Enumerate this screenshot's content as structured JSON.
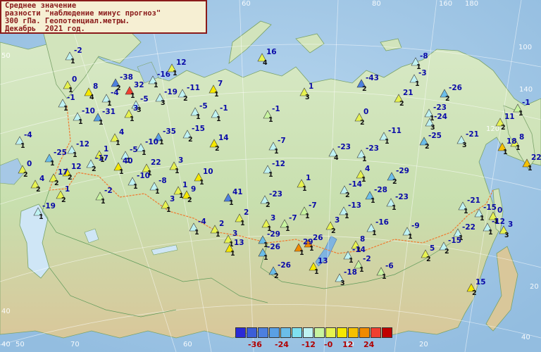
{
  "title": {
    "line1": "Среднее значение",
    "line2": "разности \"наблюдение минус прогноз\"",
    "line3": "300 гПа. Геопотенциал.метры.",
    "line4": "Декабрь  2021 год."
  },
  "scale": {
    "colors": [
      "#2b2bd6",
      "#3b5ed8",
      "#4c7fde",
      "#5aa0e4",
      "#6bbde8",
      "#7fe0f0",
      "#bff2f2",
      "#c8f4a0",
      "#e6f250",
      "#f5e800",
      "#f5c000",
      "#f08a00",
      "#f04030",
      "#c00000"
    ],
    "labels": [
      "-36",
      "-24",
      "-12",
      "-0",
      "12",
      "24"
    ]
  },
  "grid_labels": [
    "60",
    "80",
    "100",
    "120",
    "140",
    "160",
    "180",
    "40",
    "40",
    "50",
    "50",
    "60",
    "70",
    "60",
    "40",
    "40",
    "20",
    "20"
  ],
  "stations": [
    {
      "v": "-2",
      "n": "1",
      "c": "#bff2f2"
    },
    {
      "v": "0",
      "n": "1",
      "c": "#e6f250"
    },
    {
      "v": "8",
      "n": "4",
      "c": "#f5e800"
    },
    {
      "v": "-1",
      "n": "1",
      "c": "#bff2f2"
    },
    {
      "v": "-4",
      "n": "1",
      "c": "#bff2f2"
    },
    {
      "v": "-38",
      "n": "2",
      "c": "#4c7fde"
    },
    {
      "v": "32",
      "n": "1",
      "c": "#f04030"
    },
    {
      "v": "-16",
      "n": "1",
      "c": "#bff2f2"
    },
    {
      "v": "12",
      "n": "1",
      "c": "#e6f250"
    },
    {
      "v": "-5",
      "n": "3",
      "c": "#bff2f2"
    },
    {
      "v": "-19",
      "n": "3",
      "c": "#bff2f2"
    },
    {
      "v": "-11",
      "n": "2",
      "c": "#bff2f2"
    },
    {
      "v": "7",
      "n": "1",
      "c": "#f5e800"
    },
    {
      "v": "16",
      "n": "4",
      "c": "#e6f250"
    },
    {
      "v": "1",
      "n": "3",
      "c": "#e6f250"
    },
    {
      "v": "-43",
      "n": "2",
      "c": "#4c7fde"
    },
    {
      "v": "-8",
      "n": "1",
      "c": "#bff2f2"
    },
    {
      "v": "-3",
      "n": "1",
      "c": "#bff2f2"
    },
    {
      "v": "21",
      "n": "2",
      "c": "#e6f250"
    },
    {
      "v": "-26",
      "n": "2",
      "c": "#6bbde8"
    },
    {
      "v": "-1",
      "n": "1",
      "c": "#c8f4a0"
    },
    {
      "v": "-31",
      "n": "1",
      "c": "#5aa0e4"
    },
    {
      "v": "3",
      "n": "1",
      "c": "#e6f250"
    },
    {
      "v": "-10",
      "n": "1",
      "c": "#bff2f2"
    },
    {
      "v": "-1",
      "n": "1",
      "c": "#bff2f2"
    },
    {
      "v": "-5",
      "n": "1",
      "c": "#bff2f2"
    },
    {
      "v": "0",
      "n": "2",
      "c": "#e6f250"
    },
    {
      "v": "-23",
      "n": "1",
      "c": "#bff2f2"
    },
    {
      "v": "-24",
      "n": "3",
      "c": "#bff2f2"
    },
    {
      "v": "11",
      "n": "2",
      "c": "#e6f250"
    },
    {
      "v": "-1",
      "n": "1",
      "c": "#c8f4a0"
    },
    {
      "v": "-4",
      "n": "1",
      "c": "#bff2f2"
    },
    {
      "v": "4",
      "n": "1",
      "c": "#e6f250"
    },
    {
      "v": "-35",
      "n": "1",
      "c": "#5aa0e4"
    },
    {
      "v": "-15",
      "n": "2",
      "c": "#bff2f2"
    },
    {
      "v": "-11",
      "n": "1",
      "c": "#bff2f2"
    },
    {
      "v": "-25",
      "n": "2",
      "c": "#6bbde8"
    },
    {
      "v": "-21",
      "n": "3",
      "c": "#bff2f2"
    },
    {
      "v": "8",
      "n": "1",
      "c": "#e6f250"
    },
    {
      "v": "18",
      "n": "1",
      "c": "#f5c000"
    },
    {
      "v": "22",
      "n": "1",
      "c": "#f5c000"
    },
    {
      "v": "-25",
      "n": "1",
      "c": "#6bbde8"
    },
    {
      "v": "-12",
      "n": "1",
      "c": "#bff2f2"
    },
    {
      "v": "1",
      "n": "1",
      "c": "#e6f250"
    },
    {
      "v": "-5",
      "n": "1",
      "c": "#bff2f2"
    },
    {
      "v": "-10",
      "n": "1",
      "c": "#bff2f2"
    },
    {
      "v": "14",
      "n": "2",
      "c": "#f5e800"
    },
    {
      "v": "-7",
      "n": "1",
      "c": "#bff2f2"
    },
    {
      "v": "-23",
      "n": "4",
      "c": "#bff2f2"
    },
    {
      "v": "-23",
      "n": "1",
      "c": "#bff2f2"
    },
    {
      "v": "0",
      "n": "2",
      "c": "#e6f250"
    },
    {
      "v": "12",
      "n": "2",
      "c": "#f5e800"
    },
    {
      "v": "-17",
      "n": "2",
      "c": "#bff2f2"
    },
    {
      "v": "40",
      "n": "1",
      "c": "#f5e800"
    },
    {
      "v": "22",
      "n": "1",
      "c": "#e6f250"
    },
    {
      "v": "3",
      "n": "1",
      "c": "#e6f250"
    },
    {
      "v": "10",
      "n": "1",
      "c": "#f5e800"
    },
    {
      "v": "-12",
      "n": "1",
      "c": "#bff2f2"
    },
    {
      "v": "1",
      "n": "1",
      "c": "#e6f250"
    },
    {
      "v": "4",
      "n": "1",
      "c": "#e6f250"
    },
    {
      "v": "-29",
      "n": "2",
      "c": "#6bbde8"
    },
    {
      "v": "4",
      "n": "2",
      "c": "#e6f250"
    },
    {
      "v": "17",
      "n": "2",
      "c": "#e6f250"
    },
    {
      "v": "-10",
      "n": "1",
      "c": "#bff2f2"
    },
    {
      "v": "-8",
      "n": "1",
      "c": "#bff2f2"
    },
    {
      "v": "1",
      "n": "1",
      "c": "#e6f250"
    },
    {
      "v": "-14",
      "n": "2",
      "c": "#bff2f2"
    },
    {
      "v": "-28",
      "n": "1",
      "c": "#6bbde8"
    },
    {
      "v": "-23",
      "n": "1",
      "c": "#bff2f2"
    },
    {
      "v": "-2",
      "n": "1",
      "c": "#c8f4a0"
    },
    {
      "v": "1",
      "n": "2",
      "c": "#e6f250"
    },
    {
      "v": "9",
      "n": "2",
      "c": "#f5e800"
    },
    {
      "v": "41",
      "n": "1",
      "c": "#4c7fde"
    },
    {
      "v": "-23",
      "n": "2",
      "c": "#bff2f2"
    },
    {
      "v": "-7",
      "n": "1",
      "c": "#c8f4a0"
    },
    {
      "v": "-13",
      "n": "1",
      "c": "#bff2f2"
    },
    {
      "v": "3",
      "n": "1",
      "c": "#e6f250"
    },
    {
      "v": "2",
      "n": "1",
      "c": "#e6f250"
    },
    {
      "v": "-19",
      "n": "1",
      "c": "#bff2f2"
    },
    {
      "v": "-4",
      "n": "1",
      "c": "#bff2f2"
    },
    {
      "v": "3",
      "n": "1",
      "c": "#e6f250"
    },
    {
      "v": "-7",
      "n": "1",
      "c": "#c8f4a0"
    },
    {
      "v": "3",
      "n": "2",
      "c": "#e6f250"
    },
    {
      "v": "-16",
      "n": "1",
      "c": "#bff2f2"
    },
    {
      "v": "2",
      "n": "1",
      "c": "#e6f250"
    },
    {
      "v": "-21",
      "n": "1",
      "c": "#bff2f2"
    },
    {
      "v": "-15",
      "n": "1",
      "c": "#bff2f2"
    },
    {
      "v": "0",
      "n": "1",
      "c": "#e6f250"
    },
    {
      "v": "-9",
      "n": "1",
      "c": "#bff2f2"
    },
    {
      "v": "-22",
      "n": "1",
      "c": "#bff2f2"
    },
    {
      "v": "-12",
      "n": "1",
      "c": "#bff2f2"
    },
    {
      "v": "3",
      "n": "1",
      "c": "#e6f250"
    },
    {
      "v": "13",
      "n": "1",
      "c": "#f5e800"
    },
    {
      "v": "-29",
      "n": "1",
      "c": "#6bbde8"
    },
    {
      "v": "26",
      "n": "1",
      "c": "#f08a00"
    },
    {
      "v": "8",
      "n": "1",
      "c": "#e6f250"
    },
    {
      "v": "5",
      "n": "2",
      "c": "#e6f250"
    },
    {
      "v": "-15",
      "n": "2",
      "c": "#bff2f2"
    },
    {
      "v": "-26",
      "n": "1",
      "c": "#6bbde8"
    },
    {
      "v": "29",
      "n": "1",
      "c": "#f08a00"
    },
    {
      "v": "-14",
      "n": "1",
      "c": "#bff2f2"
    },
    {
      "v": "13",
      "n": "1",
      "c": "#f5e800"
    },
    {
      "v": "-2",
      "n": "1",
      "c": "#c8f4a0"
    },
    {
      "v": "-6",
      "n": "1",
      "c": "#c8f4a0"
    },
    {
      "v": "-26",
      "n": "2",
      "c": "#6bbde8"
    },
    {
      "v": "-18",
      "n": "3",
      "c": "#bff2f2"
    },
    {
      "v": "15",
      "n": "2",
      "c": "#f5e800"
    },
    {
      "v": "3",
      "n": "3",
      "c": "#e6f250"
    }
  ]
}
